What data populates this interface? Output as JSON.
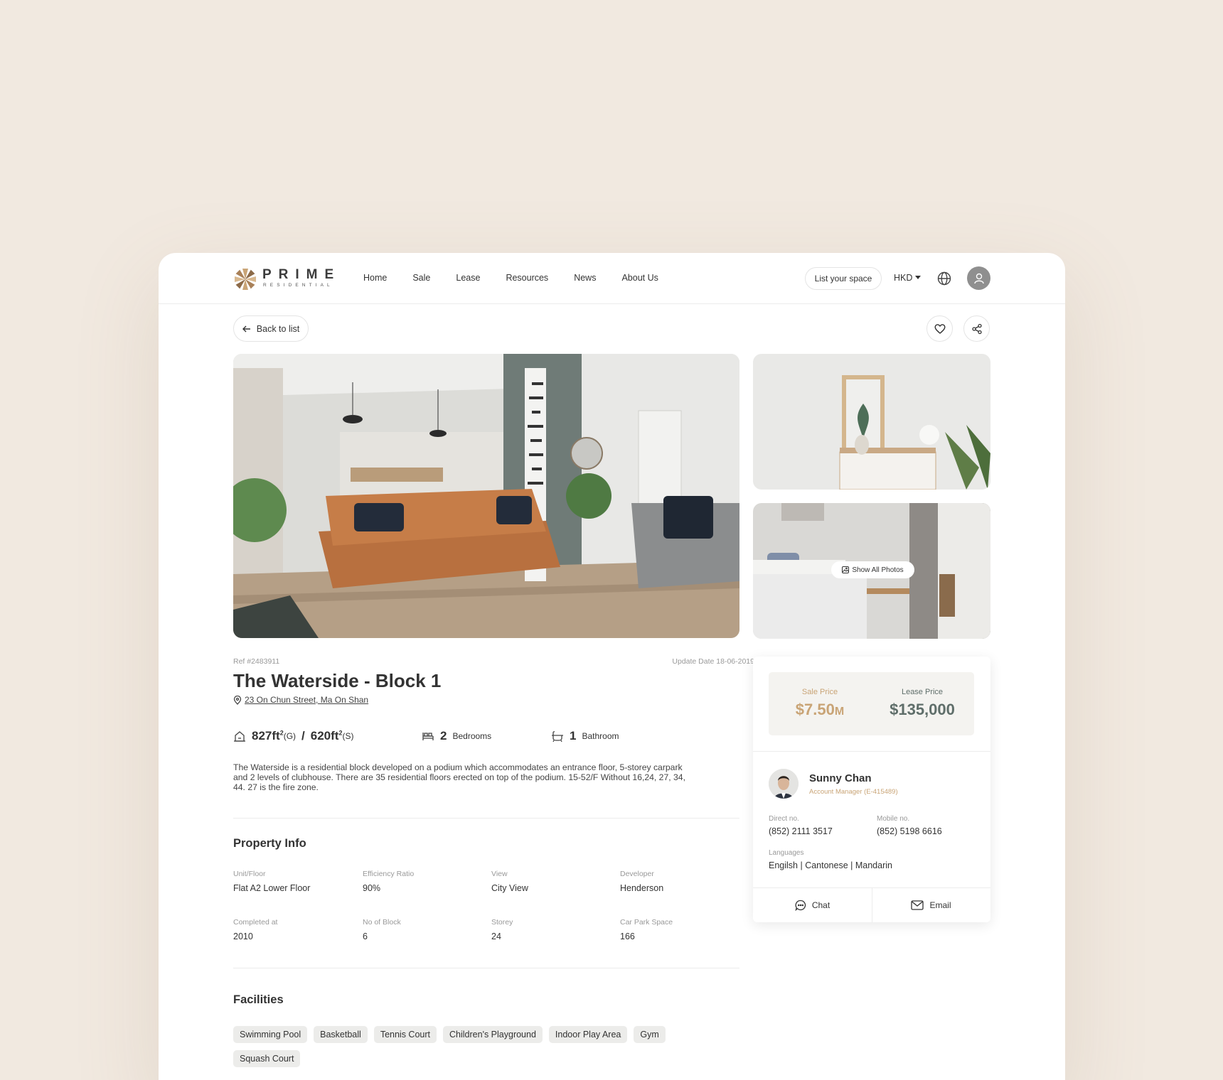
{
  "brand": {
    "name": "PRIME",
    "sub": "RESIDENTIAL"
  },
  "nav": {
    "items": [
      "Home",
      "Sale",
      "Lease",
      "Resources",
      "News",
      "About Us"
    ]
  },
  "header": {
    "list_space": "List your space",
    "currency": "HKD"
  },
  "toolbar": {
    "back": "Back to list"
  },
  "gallery": {
    "show_all": "Show All Photos"
  },
  "property": {
    "ref": "Ref #2483911",
    "update_date": "Update Date 18-06-2019",
    "title": "The Waterside - Block 1",
    "address": "23 On Chun Street, Ma On Shan",
    "area_gross": "827ft",
    "area_gross_unit": "(G)",
    "area_sep": "/",
    "area_saleable": "620ft",
    "area_saleable_unit": "(S)",
    "area_sup": "2",
    "bedrooms": "2",
    "bedrooms_label": "Bedrooms",
    "bathrooms": "1",
    "bathrooms_label": "Bathroom",
    "description": "The Waterside is a residential block developed on a podium which accommodates an entrance floor, 5-storey carpark and 2 levels of clubhouse. There are 35 residential floors erected on top of the podium. 15-52/F Without 16,24, 27, 34, 44. 27 is the fire zone."
  },
  "property_info": {
    "title": "Property Info",
    "fields": [
      {
        "label": "Unit/Floor",
        "value": "Flat A2 Lower Floor"
      },
      {
        "label": "Efficiency Ratio",
        "value": "90%"
      },
      {
        "label": "View",
        "value": "City View"
      },
      {
        "label": "Developer",
        "value": "Henderson"
      },
      {
        "label": "Completed at",
        "value": "2010"
      },
      {
        "label": "No of Block",
        "value": "6"
      },
      {
        "label": "Storey",
        "value": "24"
      },
      {
        "label": "Car Park Space",
        "value": "166"
      }
    ]
  },
  "facilities": {
    "title": "Facilities",
    "items": [
      "Swimming Pool",
      "Basketball",
      "Tennis Court",
      "Children's Playground",
      "Indoor Play Area",
      "Gym",
      "Squash Court"
    ]
  },
  "pricing": {
    "sale_label": "Sale Price",
    "sale_value": "$7.50",
    "sale_unit": "M",
    "lease_label": "Lease Price",
    "lease_value": "$135,000"
  },
  "agent": {
    "name": "Sunny Chan",
    "role": "Account Manager (E-415489)",
    "direct_label": "Direct no.",
    "direct": "(852) 2111 3517",
    "mobile_label": "Mobile no.",
    "mobile": "(852) 5198 6616",
    "languages_label": "Languages",
    "languages": "Engilsh | Cantonese | Mandarin",
    "chat": "Chat",
    "email": "Email"
  },
  "colors": {
    "background": "#f1e9e0",
    "accent_gold": "#c9a476",
    "lease_green": "#5f6e6a",
    "text": "#333333"
  }
}
